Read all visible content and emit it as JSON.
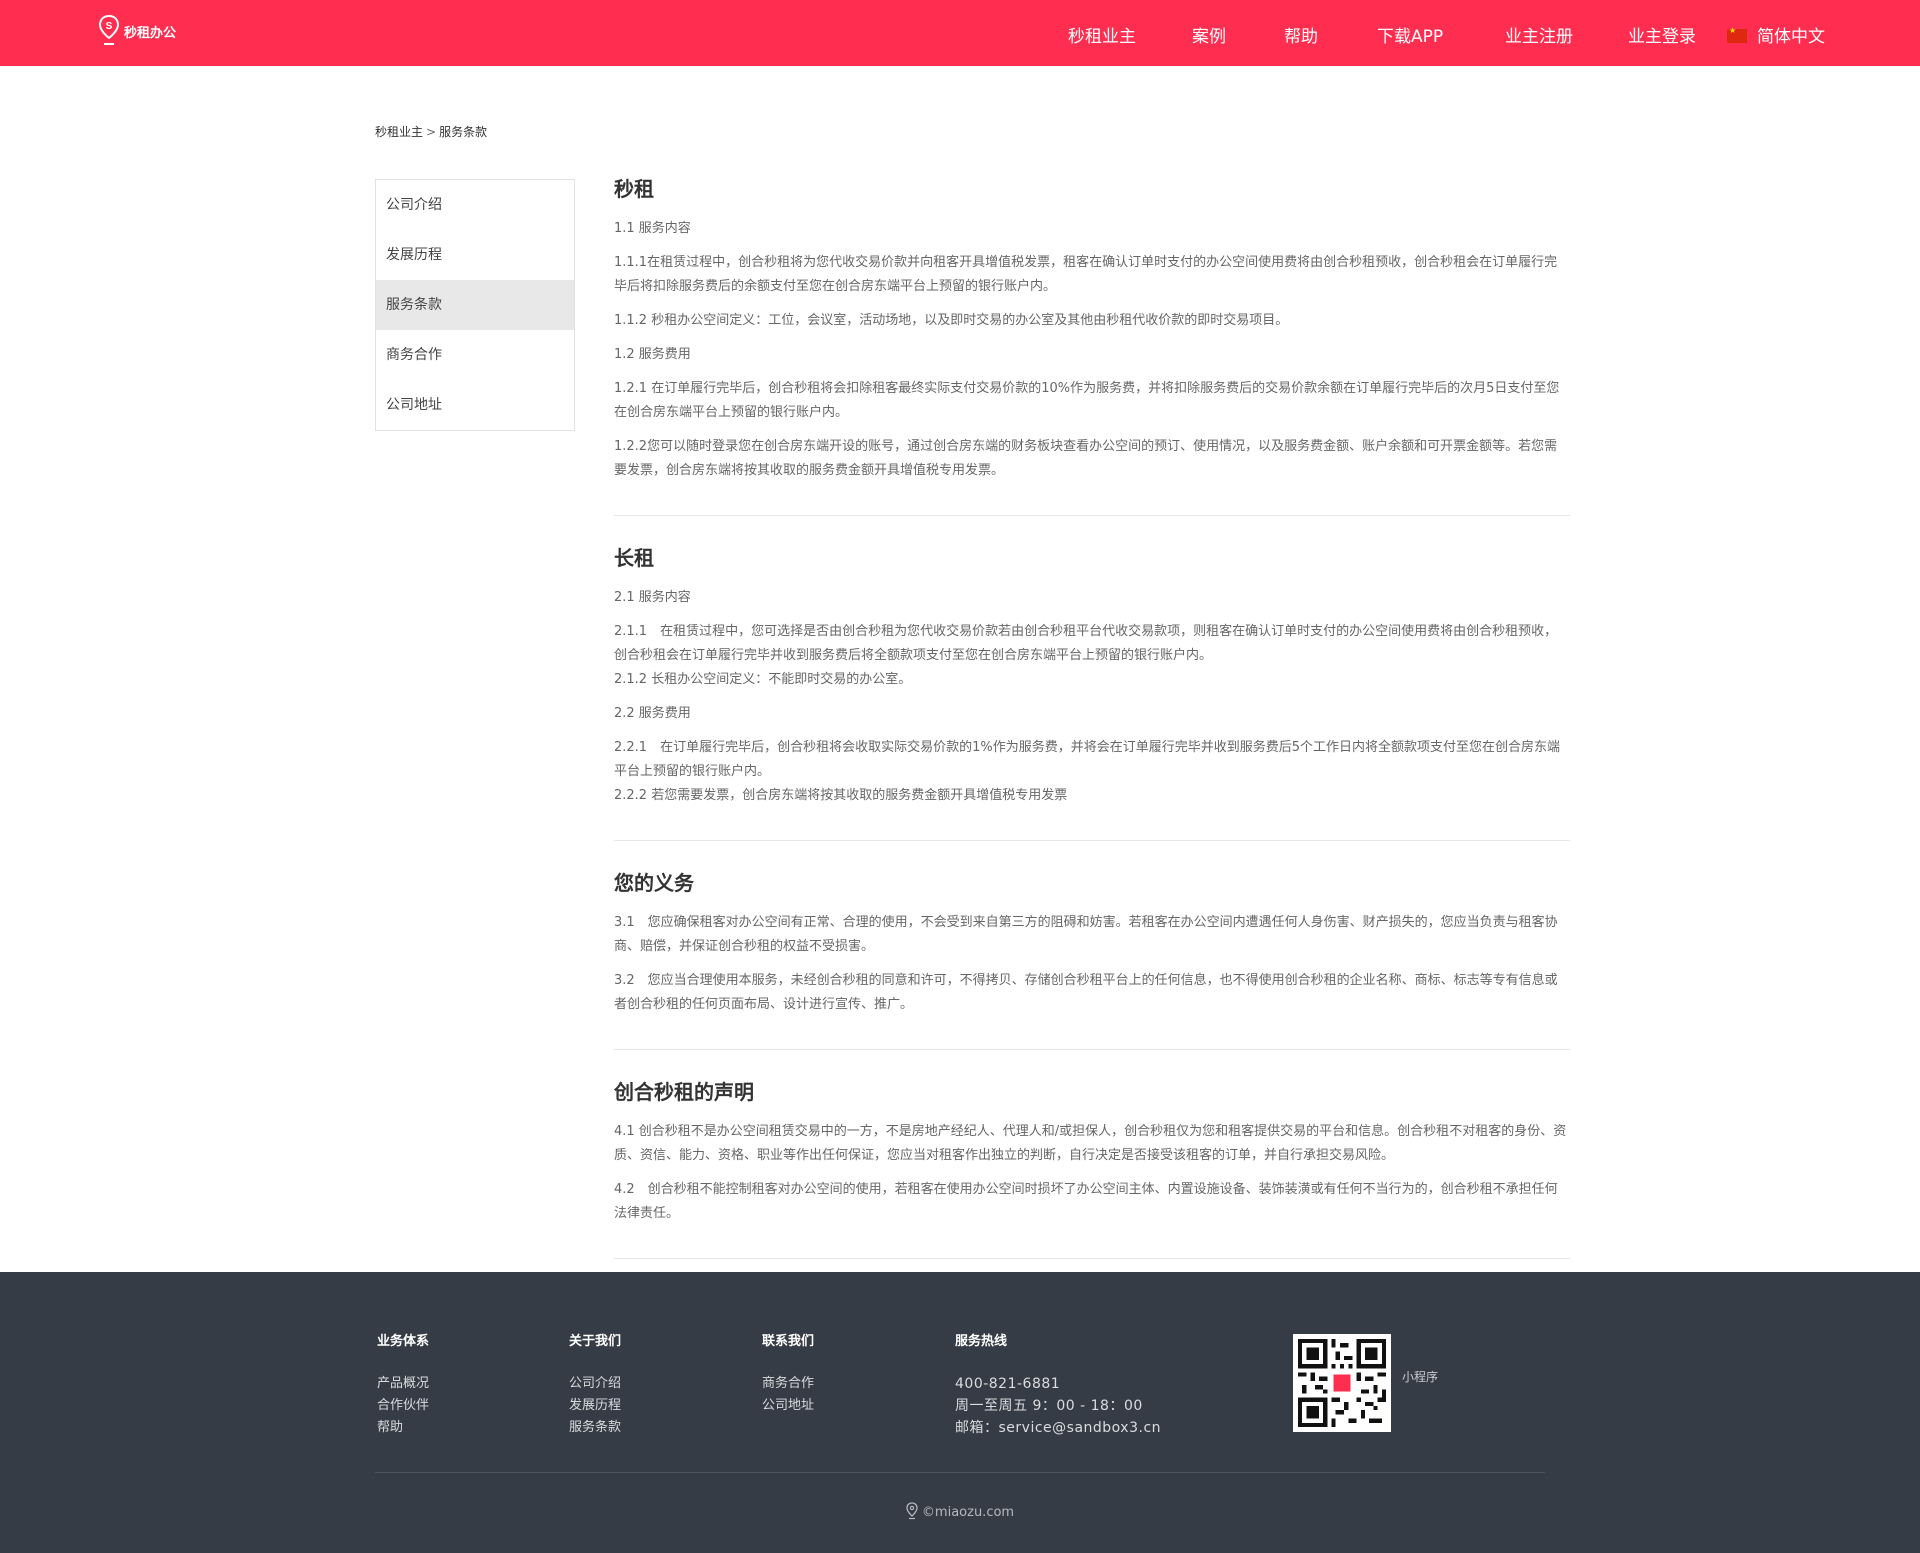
{
  "header": {
    "logo_text": "秒租办公",
    "brand_color": "#ff2d4f",
    "nav": [
      {
        "label": "秒租业主"
      },
      {
        "label": "案例"
      },
      {
        "label": "帮助"
      },
      {
        "label": "下载APP"
      },
      {
        "label": "业主注册"
      },
      {
        "label": "业主登录"
      },
      {
        "label": "简体中文",
        "icon": "china-flag-icon"
      }
    ]
  },
  "breadcrumb": {
    "parent": "秒租业主",
    "separator": ">",
    "current": "服务条款"
  },
  "sidebar": {
    "items": [
      {
        "label": "公司介绍",
        "active": false
      },
      {
        "label": "发展历程",
        "active": false
      },
      {
        "label": "服务条款",
        "active": true
      },
      {
        "label": "商务合作",
        "active": false
      },
      {
        "label": "公司地址",
        "active": false
      }
    ]
  },
  "sections": [
    {
      "title": "秒租",
      "paras": [
        "1.1 服务内容",
        "1.1.1在租赁过程中，创合秒租将为您代收交易价款并向租客开具增值税发票，租客在确认订单时支付的办公空间使用费将由创合秒租预收，创合秒租会在订单履行完毕后将扣除服务费后的余额支付至您在创合房东端平台上预留的银行账户内。",
        "1.1.2 秒租办公空间定义：工位，会议室，活动场地，以及即时交易的办公室及其他由秒租代收价款的即时交易项目。",
        "1.2 服务费用",
        "1.2.1 在订单履行完毕后，创合秒租将会扣除租客最终实际支付交易价款的10%作为服务费，并将扣除服务费后的交易价款余额在订单履行完毕后的次月5日支付至您在创合房东端平台上预留的银行账户内。",
        "1.2.2您可以随时登录您在创合房东端开设的账号，通过创合房东端的财务板块查看办公空间的预订、使用情况，以及服务费金额、账户余额和可开票金额等。若您需要发票，创合房东端将按其收取的服务费金额开具增值税专用发票。"
      ]
    },
    {
      "title": "长租",
      "p1": "2.1 服务内容",
      "p2": "2.1.1　在租赁过程中，您可选择是否由创合秒租为您代收交易价款若由创合秒租平台代收交易款项，则租客在确认订单时支付的办公空间使用费将由创合秒租预收，创合秒租会在订单履行完毕并收到服务费后将全额款项支付至您在创合房东端平台上预留的银行账户内。",
      "p3": "2.1.2 长租办公空间定义：不能即时交易的办公室。",
      "p4": "2.2 服务费用",
      "p5": "2.2.1　在订单履行完毕后，创合秒租将会收取实际交易价款的1%作为服务费，并将会在订单履行完毕并收到服务费后5个工作日内将全额款项支付至您在创合房东端平台上预留的银行账户内。",
      "p6": "2.2.2 若您需要发票，创合房东端将按其收取的服务费金额开具增值税专用发票"
    },
    {
      "title": "您的义务",
      "paras": [
        "3.1　您应确保租客对办公空间有正常、合理的使用，不会受到来自第三方的阻碍和妨害。若租客在办公空间内遭遇任何人身伤害、财产损失的，您应当负责与租客协商、赔偿，并保证创合秒租的权益不受损害。",
        "3.2　您应当合理使用本服务，未经创合秒租的同意和许可，不得拷贝、存储创合秒租平台上的任何信息，也不得使用创合秒租的企业名称、商标、标志等专有信息或者创合秒租的任何页面布局、设计进行宣传、推广。"
      ]
    },
    {
      "title": "创合秒租的声明",
      "paras": [
        "4.1 创合秒租不是办公空间租赁交易中的一方，不是房地产经纪人、代理人和/或担保人，创合秒租仅为您和租客提供交易的平台和信息。创合秒租不对租客的身份、资质、资信、能力、资格、职业等作出任何保证，您应当对租客作出独立的判断，自行决定是否接受该租客的订单，并自行承担交易风险。",
        "4.2　创合秒租不能控制租客对办公空间的使用，若租客在使用办公空间时损坏了办公空间主体、内置设施设备、装饰装潢或有任何不当行为的，创合秒租不承担任何法律责任。"
      ]
    }
  ],
  "footer": {
    "bg_color": "#363c45",
    "business": {
      "title": "业务体系",
      "links": [
        "产品概况",
        "合作伙伴",
        "帮助"
      ]
    },
    "about": {
      "title": "关于我们",
      "links": [
        "公司介绍",
        "发展历程",
        "服务条款"
      ]
    },
    "contact": {
      "title": "联系我们",
      "links": [
        "商务合作",
        "公司地址"
      ]
    },
    "hotline": {
      "title": "服务热线",
      "phone": "400-821-6881",
      "hours": "周一至周五 9：00 - 18：00",
      "email": "邮箱：service@sandbox3.cn"
    },
    "qr_label": "小程序",
    "copyright": "©miaozu.com"
  }
}
